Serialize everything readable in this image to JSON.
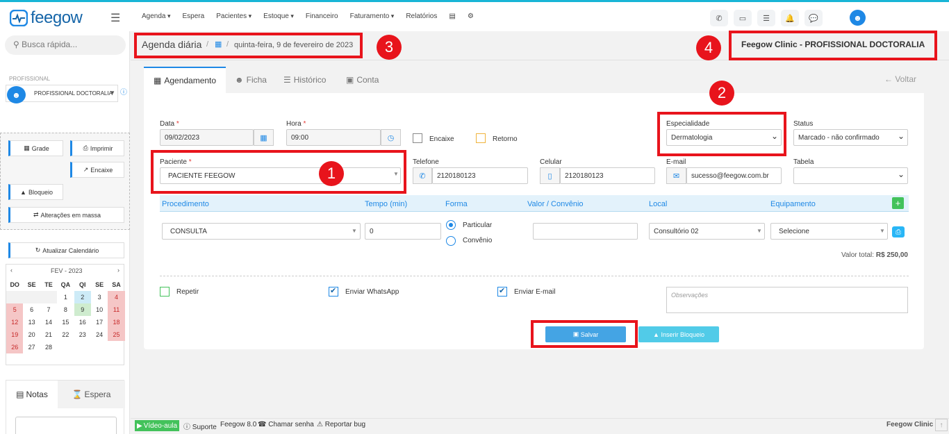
{
  "app": {
    "logo": "feegow"
  },
  "nav": {
    "items": [
      "Agenda",
      "Espera",
      "Pacientes",
      "Estoque",
      "Financeiro",
      "Faturamento",
      "Relatórios"
    ],
    "caret_items": [
      0,
      2,
      3,
      5
    ]
  },
  "sidebar": {
    "search_placeholder": "Busca rápida...",
    "prof_label": "PROFISSIONAL",
    "prof_name": "PROFISSIONAL DOCTORALIA",
    "btn_grade": "Grade",
    "btn_imprimir": "Imprimir",
    "btn_encaixe": "Encaixe",
    "btn_bloqueio": "Bloqueio",
    "btn_alteracoes": "Alterações em massa",
    "btn_atualizar": "Atualizar Calendário",
    "calendar": {
      "month": "FEV - 2023",
      "weekdays": [
        "DO",
        "SE",
        "TE",
        "QA",
        "QI",
        "SE",
        "SA"
      ],
      "rows": [
        [
          "",
          "",
          "",
          "1",
          "2",
          "3",
          "4"
        ],
        [
          "5",
          "6",
          "7",
          "8",
          "9",
          "10",
          "11"
        ],
        [
          "12",
          "13",
          "14",
          "15",
          "16",
          "17",
          "18"
        ],
        [
          "19",
          "20",
          "21",
          "22",
          "23",
          "24",
          "25"
        ],
        [
          "26",
          "27",
          "28",
          "",
          "",
          "",
          ""
        ]
      ]
    },
    "tab_notas": "Notas",
    "tab_espera": "Espera"
  },
  "header": {
    "title": "Agenda diária",
    "date": "quinta-feira, 9 de fevereiro de 2023",
    "clinic": "Feegow Clinic - PROFISSIONAL DOCTORALIA"
  },
  "tabs": {
    "agendamento": "Agendamento",
    "ficha": "Ficha",
    "historico": "Histórico",
    "conta": "Conta",
    "voltar": "Voltar"
  },
  "form": {
    "data_label": "Data",
    "data_value": "09/02/2023",
    "hora_label": "Hora",
    "hora_value": "09:00",
    "encaixe": "Encaixe",
    "retorno": "Retorno",
    "especialidade_label": "Especialidade",
    "especialidade_value": "Dermatologia",
    "status_label": "Status",
    "status_value": "Marcado - não confirmado",
    "paciente_label": "Paciente",
    "paciente_value": "PACIENTE FEEGOW",
    "telefone_label": "Telefone",
    "telefone_value": "2120180123",
    "celular_label": "Celular",
    "celular_value": "2120180123",
    "email_label": "E-mail",
    "email_value": "sucesso@feegow.com.br",
    "tabela_label": "Tabela",
    "tabela_value": ""
  },
  "table": {
    "headers": [
      "Procedimento",
      "Tempo (min)",
      "Forma",
      "Valor / Convênio",
      "Local",
      "Equipamento"
    ],
    "procedimento": "CONSULTA",
    "tempo": "0",
    "forma_opts": [
      "Particular",
      "Convênio"
    ],
    "valor": "",
    "local": "Consultório 02",
    "equipamento": "Selecione",
    "total_label": "Valor total:",
    "total_value": "R$ 250,00"
  },
  "options": {
    "repetir": "Repetir",
    "whatsapp": "Enviar WhatsApp",
    "email": "Enviar E-mail",
    "observacoes_placeholder": "Observações"
  },
  "actions": {
    "salvar": "Salvar",
    "inserir_bloqueio": "Inserir Bloqueio"
  },
  "badges": [
    "1",
    "2",
    "3",
    "4"
  ],
  "footer": {
    "video": "Vídeo-aula",
    "suporte": "Suporte",
    "version": "Feegow 8.0",
    "chamar": "Chamar senha",
    "reportar": "Reportar bug",
    "brand": "Feegow Clinic"
  },
  "colors": {
    "accent": "#1e88e5",
    "highlight": "#e8141c",
    "brand": "#1565a8"
  }
}
